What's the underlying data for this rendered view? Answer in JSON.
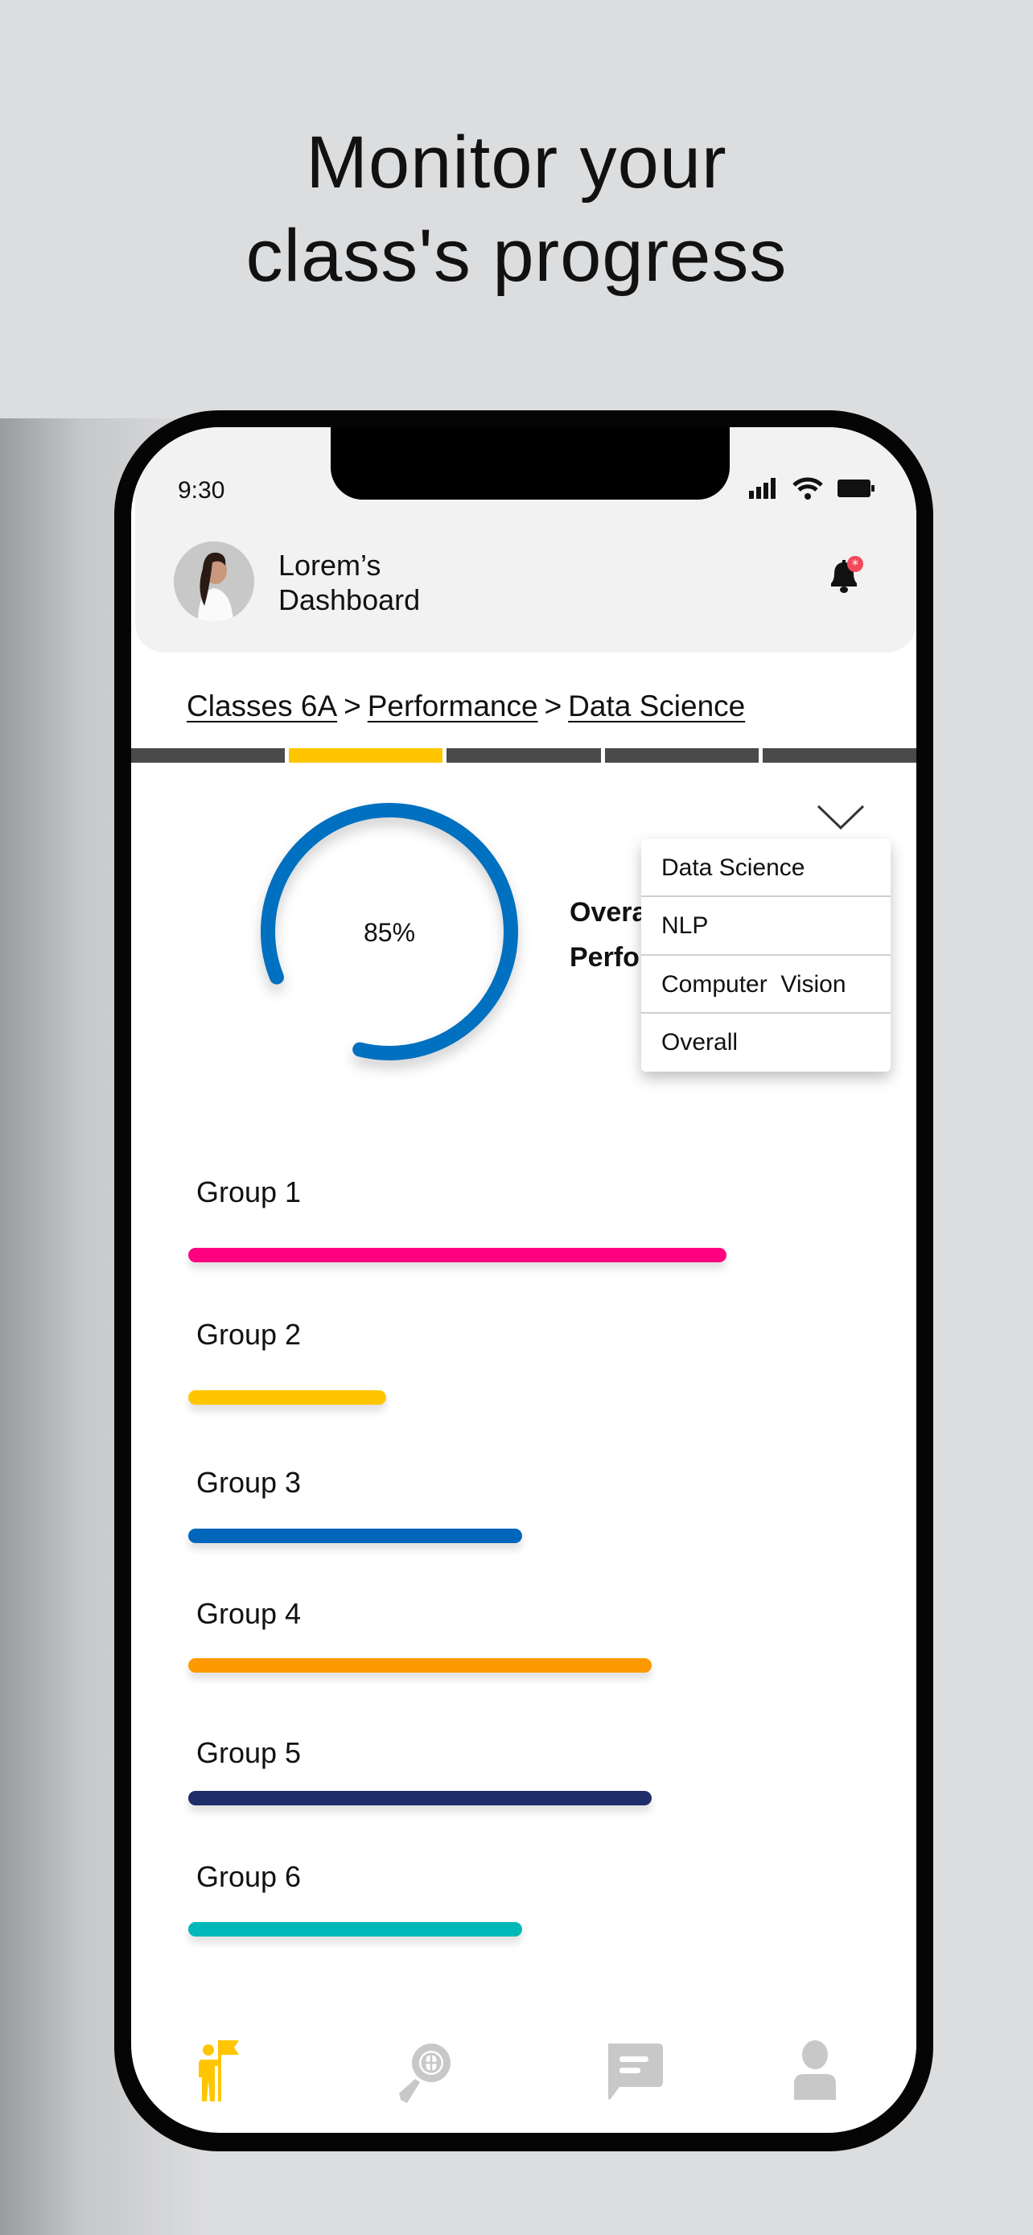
{
  "headline": {
    "line1": "Monitor your",
    "line2": "class's progress"
  },
  "status_bar": {
    "time": "9:30"
  },
  "header": {
    "title_line1": "Lorem’s",
    "title_line2": "Dashboard",
    "notification_badge": "*"
  },
  "breadcrumb": [
    {
      "label": "Classes 6A"
    },
    {
      "label": "Performance"
    },
    {
      "label": "Data Science"
    }
  ],
  "breadcrumb_separator": ">",
  "step_indicator": {
    "total": 5,
    "active_index": 1,
    "active_color": "#ffc600",
    "inactive_color": "#4a4a4a"
  },
  "overall": {
    "percent": 85,
    "percent_label": "85%",
    "title_line1": "Overall",
    "title_line2": "Performance",
    "ring_color": "#0070c0"
  },
  "dropdown": {
    "options": [
      "Data Science",
      "NLP",
      "Computer  Vision",
      "Overall"
    ]
  },
  "groups": [
    {
      "label": "Group 1",
      "percent": 79,
      "color": "#ff0080"
    },
    {
      "label": "Group 2",
      "percent": 29,
      "color": "#ffc600"
    },
    {
      "label": "Group 3",
      "percent": 49,
      "color": "#0066bb"
    },
    {
      "label": "Group 4",
      "percent": 68,
      "color": "#ff9900"
    },
    {
      "label": "Group 5",
      "percent": 68,
      "color": "#1f2d6b"
    },
    {
      "label": "Group 6",
      "percent": 49,
      "color": "#00b8b8"
    }
  ],
  "bottom_nav": [
    {
      "icon": "person-flag-icon",
      "active": true
    },
    {
      "icon": "globe-search-icon",
      "active": false
    },
    {
      "icon": "chat-icon",
      "active": false
    },
    {
      "icon": "profile-icon",
      "active": false
    }
  ],
  "colors": {
    "nav_active": "#ffc600",
    "nav_inactive": "#c8c8c8",
    "badge": "#f04a5a"
  }
}
